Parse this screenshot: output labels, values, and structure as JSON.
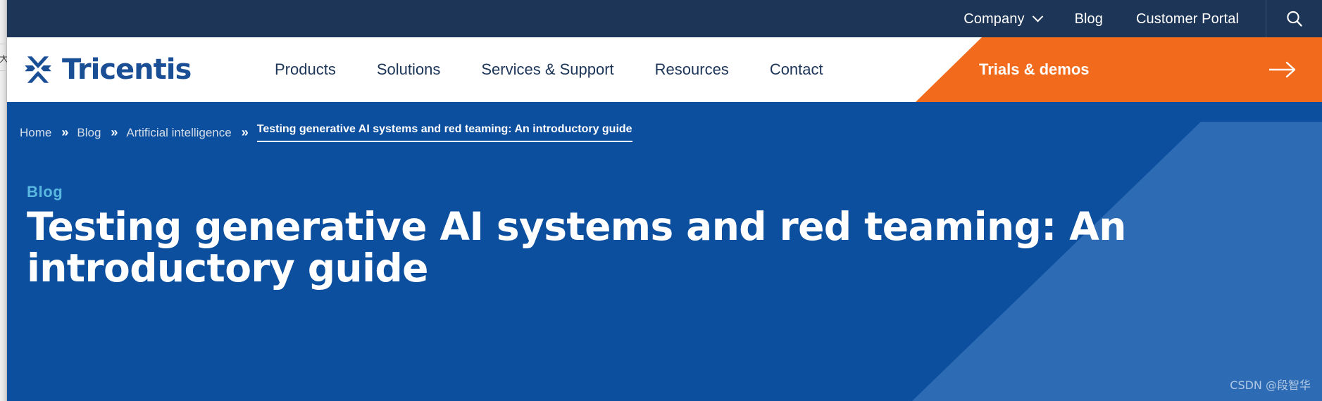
{
  "colors": {
    "utility_bar_bg": "#1d3557",
    "header_bg": "#ffffff",
    "brand_blue": "#1a4f96",
    "hero_bg": "#0b4f9e",
    "hero_wedge": "#2d6cb5",
    "cta_orange": "#f26a1b",
    "eyebrow_cyan": "#5bb8e0",
    "nav_text": "#1d3557"
  },
  "browser_chrome": {
    "partial_glyph": "大"
  },
  "utility_bar": {
    "items": [
      {
        "label": "Company",
        "icon": "chevron-down-icon",
        "has_dropdown": true
      },
      {
        "label": "Blog",
        "has_dropdown": false
      },
      {
        "label": "Customer Portal",
        "has_dropdown": false
      }
    ],
    "search_icon": "search-icon"
  },
  "header": {
    "logo": {
      "text": "Tricentis",
      "mark": "tricentis-x-logo-icon"
    },
    "nav": [
      {
        "label": "Products"
      },
      {
        "label": "Solutions"
      },
      {
        "label": "Services & Support"
      },
      {
        "label": "Resources"
      },
      {
        "label": "Contact"
      }
    ],
    "cta": {
      "label": "Trials & demos",
      "arrow_icon": "arrow-right-icon"
    }
  },
  "hero": {
    "breadcrumb": {
      "separator": "»",
      "items": [
        {
          "label": "Home",
          "current": false
        },
        {
          "label": "Blog",
          "current": false
        },
        {
          "label": "Artificial intelligence",
          "current": false
        },
        {
          "label": "Testing generative AI systems and red teaming: An introductory guide",
          "current": true
        }
      ]
    },
    "eyebrow": "Blog",
    "title": "Testing generative AI systems and red teaming: An introductory guide"
  },
  "watermark": {
    "text": "CSDN @段智华"
  }
}
